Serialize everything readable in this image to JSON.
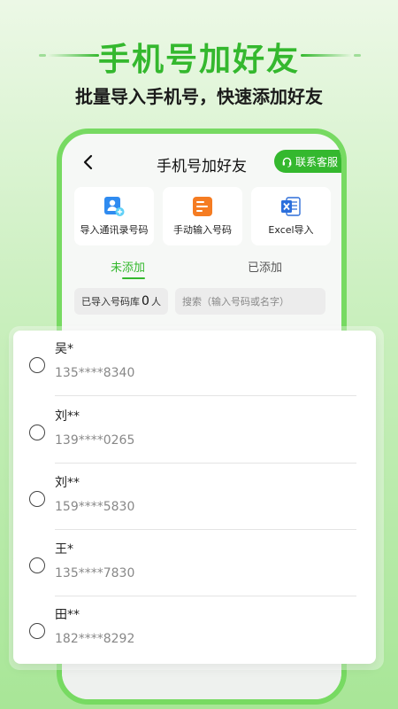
{
  "hero": {
    "title": "手机号加好友",
    "subtitle": "批量导入手机号，快速添加好友"
  },
  "nav": {
    "title": "手机号加好友",
    "service_label": "联系客服"
  },
  "cards": [
    {
      "label": "导入通讯录号码",
      "icon": "contacts-add-icon"
    },
    {
      "label": "手动输入号码",
      "icon": "manual-input-icon"
    },
    {
      "label": "Excel导入",
      "icon": "excel-icon"
    }
  ],
  "tabs": {
    "active": "未添加",
    "inactive": "已添加"
  },
  "library": {
    "label": "已导入号码库",
    "count": "0",
    "unit": "人"
  },
  "search": {
    "placeholder": "搜索（输入号码或名字）"
  },
  "contacts": [
    {
      "name": "吴*",
      "phone": "135****8340"
    },
    {
      "name": "刘**",
      "phone": "139****0265"
    },
    {
      "name": "刘**",
      "phone": "159****5830"
    },
    {
      "name": "王*",
      "phone": "135****7830"
    },
    {
      "name": "田**",
      "phone": "182****8292"
    }
  ],
  "colors": {
    "accent": "#34b82e",
    "phone_frame": "#77da62"
  }
}
